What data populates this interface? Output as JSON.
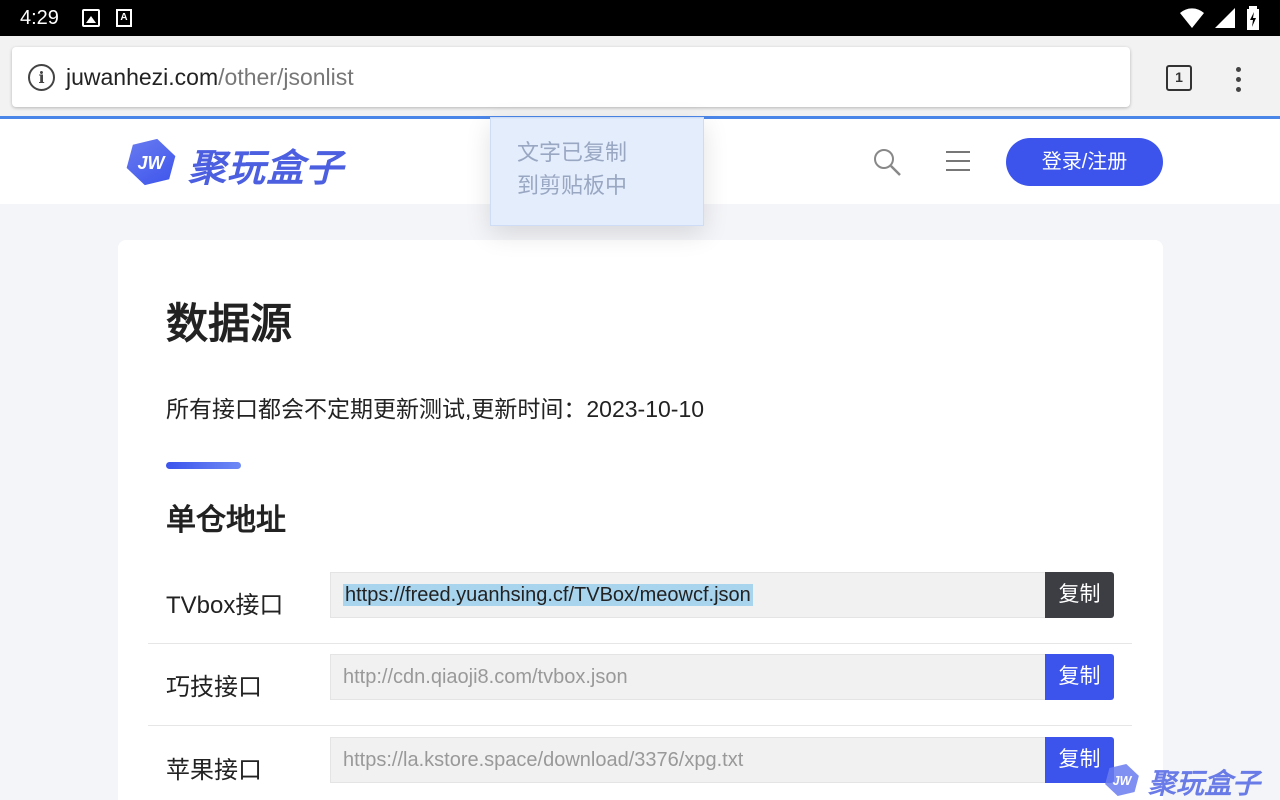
{
  "status_bar": {
    "time": "4:29"
  },
  "browser": {
    "url_domain": "juwanhezi.com",
    "url_path": "/other/jsonlist",
    "tab_count": "1"
  },
  "header": {
    "logo_badge": "JW",
    "logo_text": "聚玩盒子",
    "login_label": "登录/注册"
  },
  "toast": {
    "line1": "文字已复制",
    "line2": "到剪贴板中"
  },
  "main": {
    "title": "数据源",
    "subtitle": "所有接口都会不定期更新测试,更新时间：2023-10-10",
    "section_title": "单仓地址",
    "rows": [
      {
        "label": "TVbox接口",
        "url": "https://freed.yuanhsing.cf/TVBox/meowcf.json",
        "copy": "复制"
      },
      {
        "label": "巧技接口",
        "url": "http://cdn.qiaoji8.com/tvbox.json",
        "copy": "复制"
      },
      {
        "label": "苹果接口",
        "url": "https://la.kstore.space/download/3376/xpg.txt",
        "copy": "复制"
      }
    ]
  },
  "watermark": {
    "badge": "JW",
    "text": "聚玩盒子"
  },
  "colors": {
    "accent": "#3c54ec",
    "selection": "#a8d4ee",
    "chrome_line": "#4a86e8"
  }
}
